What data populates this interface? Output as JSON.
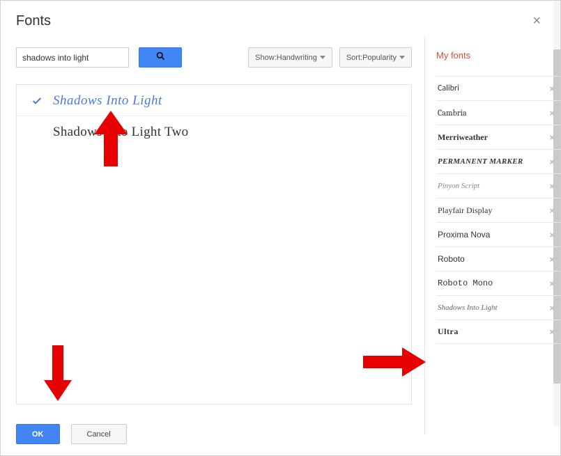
{
  "dialog": {
    "title": "Fonts"
  },
  "search": {
    "value": "shadows into light"
  },
  "show_filter": {
    "label": "Show: ",
    "value": "Handwriting"
  },
  "sort_filter": {
    "label": "Sort: ",
    "value": "Popularity"
  },
  "results": [
    {
      "name": "Shadows Into Light",
      "selected": true
    },
    {
      "name": "Shadows Into Light Two",
      "selected": false
    }
  ],
  "my_fonts": {
    "title": "My fonts",
    "items": [
      {
        "name": "Calibri",
        "class": "f-calibri"
      },
      {
        "name": "Cambria",
        "class": "f-cambria"
      },
      {
        "name": "Merriweather",
        "class": "f-merri"
      },
      {
        "name": "Permanent Marker",
        "class": "f-perm"
      },
      {
        "name": "Pinyon Script",
        "class": "f-pinyon"
      },
      {
        "name": "Playfair Display",
        "class": "f-playfair"
      },
      {
        "name": "Proxima Nova",
        "class": "f-proxima"
      },
      {
        "name": "Roboto",
        "class": "f-roboto"
      },
      {
        "name": "Roboto Mono",
        "class": "f-roboto-mono"
      },
      {
        "name": "Shadows Into Light",
        "class": "f-shadows"
      },
      {
        "name": "Ultra",
        "class": "f-ultra"
      }
    ]
  },
  "footer": {
    "ok": "OK",
    "cancel": "Cancel"
  }
}
